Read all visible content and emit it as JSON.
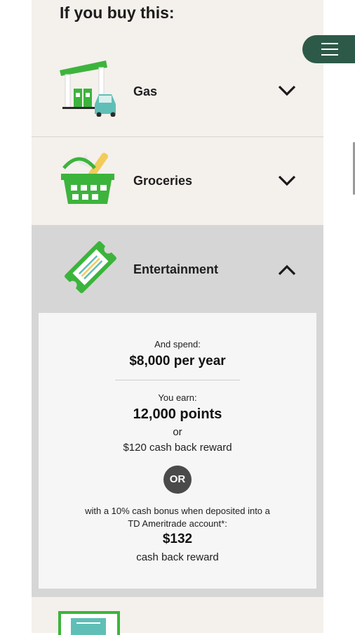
{
  "heading": "If you buy this:",
  "categories": [
    {
      "label": "Gas",
      "icon": "gas-station-icon",
      "expanded": false
    },
    {
      "label": "Groceries",
      "icon": "grocery-basket-icon",
      "expanded": false
    },
    {
      "label": "Entertainment",
      "icon": "ticket-icon",
      "expanded": true
    },
    {
      "label": "",
      "icon": "document-icon",
      "expanded": false
    }
  ],
  "detail": {
    "spend_label": "And spend:",
    "spend_value": "$8,000 per year",
    "earn_label": "You earn:",
    "points": "12,000 points",
    "or_text": "or",
    "cashback": "$120 cash back reward",
    "or_badge": "OR",
    "bonus_line1": "with a 10% cash bonus when deposited into a",
    "bonus_line2": "TD Ameritrade account*:",
    "bonus_value": "$132",
    "bonus_cashback": "cash back reward"
  },
  "menu_icon": "hamburger-menu-icon",
  "colors": {
    "brand_green": "#2d5a48",
    "icon_green": "#3cb43c",
    "panel_bg": "#f4f0ec",
    "expanded_bg": "#d6d6d6"
  }
}
